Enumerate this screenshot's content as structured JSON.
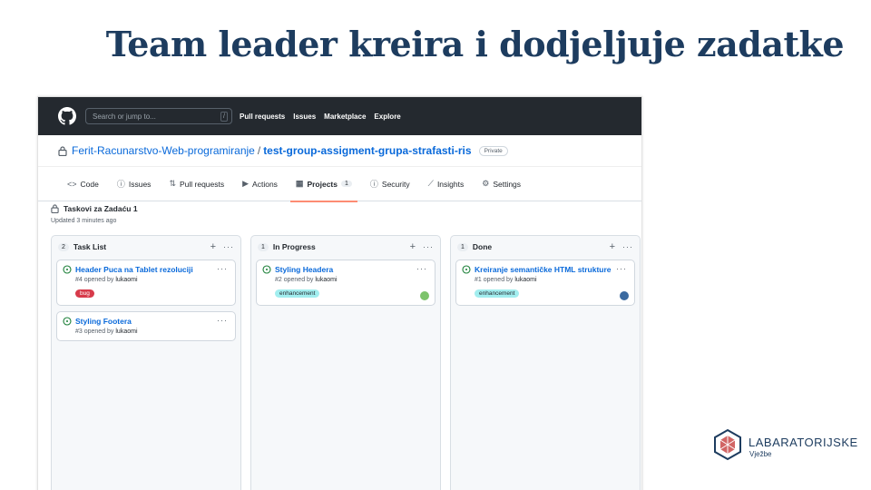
{
  "slide": {
    "title": "Team leader kreira i dodjeljuje zadatke"
  },
  "topbar": {
    "search_placeholder": "Search or jump to...",
    "search_shortcut": "/",
    "nav": [
      "Pull requests",
      "Issues",
      "Marketplace",
      "Explore"
    ]
  },
  "repo": {
    "owner": "Ferit-Racunarstvo-Web-programiranje",
    "separator": "/",
    "name": "test-group-assigment-grupa-strafasti-ris",
    "visibility": "Private"
  },
  "tabs": [
    {
      "label": "Code",
      "icon": "code-icon",
      "glyph": "<>"
    },
    {
      "label": "Issues",
      "icon": "issue-icon",
      "glyph": "ⓘ"
    },
    {
      "label": "Pull requests",
      "icon": "pull-request-icon",
      "glyph": "⇅"
    },
    {
      "label": "Actions",
      "icon": "play-icon",
      "glyph": "▶"
    },
    {
      "label": "Projects",
      "icon": "project-icon",
      "glyph": "▦",
      "count": "1",
      "active": true
    },
    {
      "label": "Security",
      "icon": "shield-icon",
      "glyph": "ⓘ"
    },
    {
      "label": "Insights",
      "icon": "graph-icon",
      "glyph": "⟋"
    },
    {
      "label": "Settings",
      "icon": "gear-icon",
      "glyph": "⚙"
    }
  ],
  "board": {
    "title": "Taskovi za Zadaću 1",
    "updated": "Updated 3 minutes ago"
  },
  "columns": [
    {
      "count": "2",
      "title": "Task List",
      "cards": [
        {
          "title": "Header Puca na Tablet rezoluciji",
          "meta_prefix": "#4 opened by ",
          "author": "lukaomi",
          "label": "bug",
          "label_color": "#d73a4a",
          "avatar": false
        },
        {
          "title": "Styling Footera",
          "meta_prefix": "#3 opened by ",
          "author": "lukaomi",
          "label": "",
          "avatar": false
        }
      ]
    },
    {
      "count": "1",
      "title": "In Progress",
      "cards": [
        {
          "title": "Styling Headera",
          "meta_prefix": "#2 opened by ",
          "author": "lukaomi",
          "label": "enhancement",
          "label_color": "#a2eeef",
          "avatar": true,
          "avatar_color": "#7cc36b"
        }
      ]
    },
    {
      "count": "1",
      "title": "Done",
      "cards": [
        {
          "title": "Kreiranje semantičke HTML strukture",
          "meta_prefix": "#1 opened by ",
          "author": "lukaomi",
          "label": "enhancement",
          "label_color": "#a2eeef",
          "avatar": true,
          "avatar_color": "#3b6aa0"
        }
      ]
    }
  ],
  "brand": {
    "name": "LABARATORIJSKE",
    "sub": "Vježbe"
  }
}
